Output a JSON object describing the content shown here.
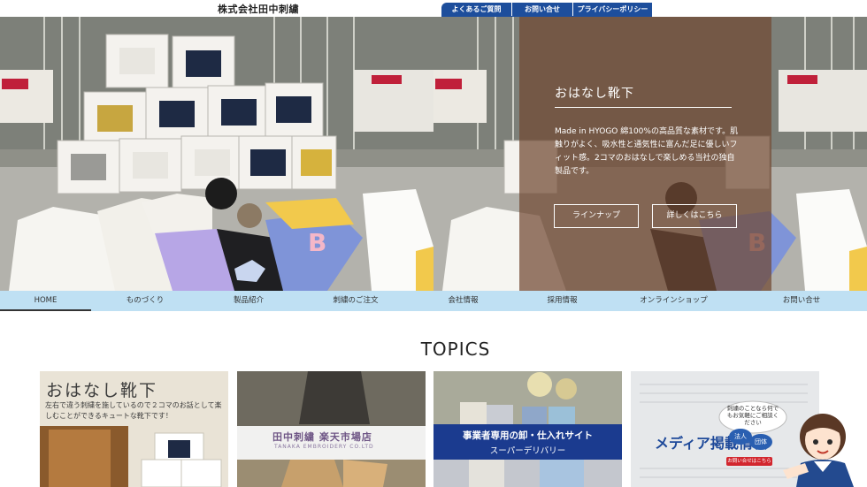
{
  "header": {
    "company": "株式会社田中刺繍",
    "links": [
      "よくあるご質問",
      "お問い合せ",
      "プライバシーポリシー"
    ]
  },
  "hero": {
    "title": "おはなし靴下",
    "description": "Made in HYOGO 綿100%の高品質な素材です。肌触りがよく、吸水性と通気性に富んだ足に優しいフィット感。2コマのおはなしで楽しめる当社の独自製品です。",
    "buttons": [
      "ラインナップ",
      "詳しくはこちら"
    ]
  },
  "nav": {
    "items": [
      "HOME",
      "ものづくり",
      "製品紹介",
      "刺繍のご注文",
      "会社情報",
      "採用情報",
      "オンラインショップ",
      "お問い合せ"
    ]
  },
  "topics": {
    "heading": "TOPICS",
    "cards": [
      {
        "title": "おはなし靴下",
        "text": "左右で違う刺繍を施しているので２コマのお話として楽しむことができるキュートな靴下です！"
      },
      {
        "title": "田中刺繍 楽天市場店",
        "sub": "TANAKA EMBROIDERY CO.LTD"
      },
      {
        "line1": "事業者専用の卸・仕入れサイト",
        "line2": "スーパーデリバリー"
      },
      {
        "title": "メディア掲載情報",
        "bubble": "刺繍のことなら何でもお気軽にご相談ください",
        "button": "お問い合せはこちら"
      }
    ]
  },
  "mascot": {
    "badge1": "法人",
    "badge2": "団体"
  },
  "colors": {
    "accent": "#1d4e9c",
    "nav_bg": "#bfe0f3",
    "overlay": "#704832"
  }
}
